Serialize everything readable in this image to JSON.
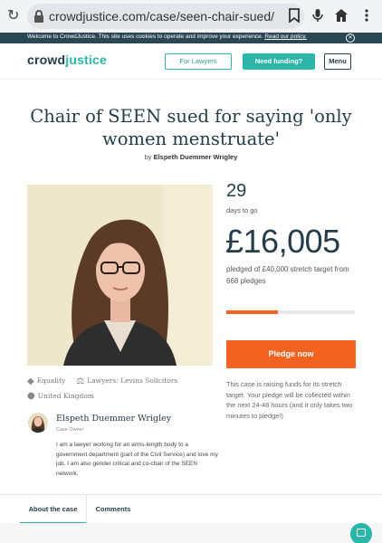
{
  "browser": {
    "url": "crowdjustice.com/case/seen-chair-sued/"
  },
  "cookie_banner": {
    "text": "Welcome to CrowdJustice. This site uses cookies to operate and improve your experience.",
    "link": "Read our policy."
  },
  "header": {
    "logo_part1": "crowd",
    "logo_part2": "justice",
    "for_lawyers": "For Lawyers",
    "need_funding": "Need funding?",
    "menu": "Menu"
  },
  "case": {
    "title": "Chair of SEEN sued for saying 'only women menstruate'",
    "byline_prefix": "by",
    "author": "Elspeth Duemmer Wrigley",
    "days": "29",
    "days_label": "days to go",
    "amount": "£16,005",
    "pledged_text": "pledged of £40,000 stretch target from 668 pledges",
    "progress_fraction": 0.4,
    "pledge_button": "Pledge now",
    "stretch_note": "This case is raising funds for its stretch target. Your pledge will be collected within the next 24-48 hours (and it only takes two minutes to pledge!)"
  },
  "tags": {
    "category": "Equality",
    "lawyers": "Lawyers: Levins Solicitors",
    "location": "United Kingdom"
  },
  "owner": {
    "name": "Elspeth Duemmer Wrigley",
    "role": "Case Owner",
    "bio": "I am a lawyer working for an arms-length body to a government department (part of the Civil Service) and love my job. I am also gender critical and co-chair of the SEEN network."
  },
  "tabs": [
    "About the case",
    "Comments"
  ],
  "colors": {
    "teal": "#2cb5a9",
    "navy": "#243d48",
    "orange": "#f26322"
  }
}
